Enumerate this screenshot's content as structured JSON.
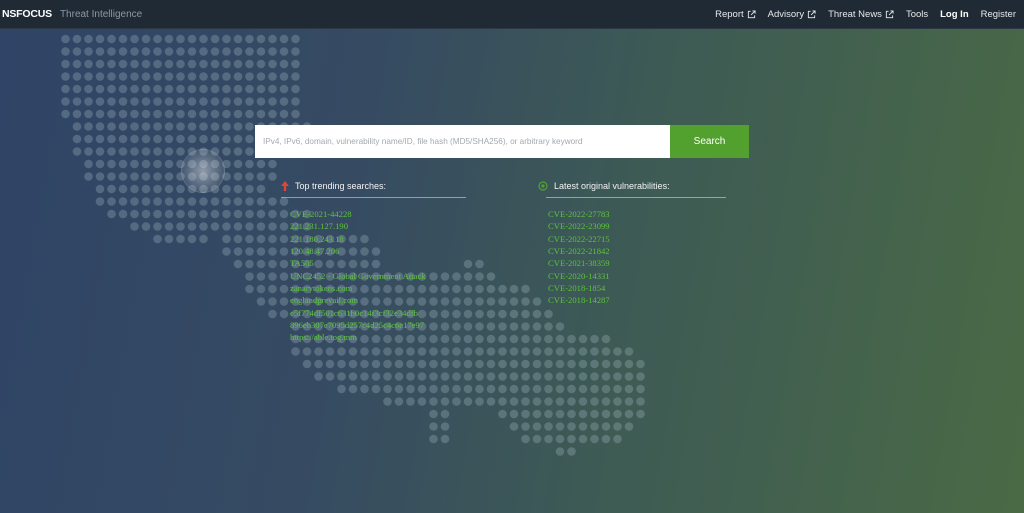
{
  "header": {
    "logo": "NSFOCUS",
    "subtitle": "Threat Intelligence",
    "nav": {
      "report": "Report",
      "advisory": "Advisory",
      "threat_news": "Threat News",
      "tools": "Tools",
      "login": "Log In",
      "register": "Register"
    }
  },
  "search": {
    "placeholder": "IPv4, IPv6, domain, vulnerability name/ID, file hash (MD5/SHA256), or arbitrary keyword",
    "value": "",
    "button_label": "Search"
  },
  "trending": {
    "title": "Top trending searches:",
    "items": [
      "CVE-2021-44228",
      "221.231.127.190",
      "221.180.243.18",
      "120.48.47.206",
      "TA505",
      "UNC2452 - Global Government Attack",
      "zanarytokens.com",
      "englandprevail.com",
      "e5f774df501c631b0c14f3cf32e34dfb",
      "896eb307e7095d257c4d25c4c6e17e97",
      "https://able.tog.mm"
    ]
  },
  "vulnerabilities": {
    "title": "Latest original vulnerabilities:",
    "items": [
      "CVE-2022-27783",
      "CVE-2022-23099",
      "CVE-2022-22715",
      "CVE-2022-21842",
      "CVE-2021-38359",
      "CVE-2020-14331",
      "CVE-2018-1854",
      "CVE-2018-14287"
    ]
  },
  "colors": {
    "accent": "#52a12f",
    "link": "#5cc43a",
    "topbar": "#1f2a34",
    "trend_icon": "#e0453a"
  }
}
